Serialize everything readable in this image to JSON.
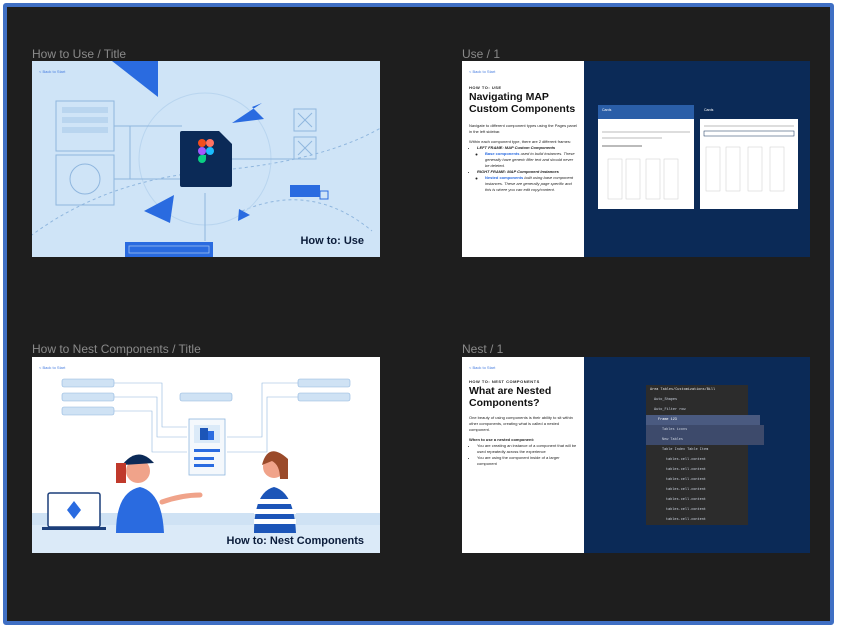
{
  "frames": [
    {
      "label": "How to Use / Title"
    },
    {
      "label": "Use / 1"
    },
    {
      "label": "How to Nest Components / Title"
    },
    {
      "label": "Nest / 1"
    }
  ],
  "back_link": "< Back to Start",
  "use_title": {
    "caption": "How to: Use"
  },
  "use_1": {
    "eyebrow": "HOW TO: USE",
    "title_line1": "Navigating MAP",
    "title_line2": "Custom Components",
    "intro": "Navigate to different component types using the Pages panel in the left sidebar.",
    "frames_intro": "Within each component type, there are 2 different frames:",
    "left_frame": "LEFT FRAME: MAP Custom Components",
    "left_link": "Base components",
    "left_desc": " used to build instances. These generally have generic filler text and should never be deleted.",
    "right_frame": "RIGHT FRAME: MAP Component Instances",
    "right_link": "Nested components",
    "right_desc": " built using base component instances. These are generally page specific and this is where you can edit copy/content.",
    "card1_title": "Cards",
    "card2_title": "Cards"
  },
  "nest_title": {
    "caption": "How to: Nest Components"
  },
  "nest_1": {
    "eyebrow": "HOW TO: NEST COMPONENTS",
    "title_line1": "What are Nested",
    "title_line2": "Components?",
    "intro": "One beauty of using components is their ability to sit within other components, creating what is called a nested component.",
    "when": "When to use a nested component:",
    "bullet1": "You are creating an instance of a component that will be used repeatedly across the experience",
    "bullet2": "You are using the component inside of a larger component",
    "layers": [
      "Area Tables/Customizations/Bill",
      "Auto_Shapes",
      "Auto_Filter row",
      "Frame 123",
      "Tables icons",
      "New Tables",
      "Table Index Table Item",
      "tables.cell.content",
      "tables.cell.content",
      "tables.cell.content",
      "tables.cell.content",
      "tables.cell.content",
      "tables.cell.content",
      "tables.cell.content",
      "tables.cell.content",
      "tables.cell.content",
      "tables.cell.content"
    ]
  },
  "colors": {
    "canvas": "#1e1e1e",
    "border": "#3f6fc4",
    "navy": "#0b2a57",
    "accent": "#2a6be0",
    "light_blue": "#cfe4f7"
  }
}
